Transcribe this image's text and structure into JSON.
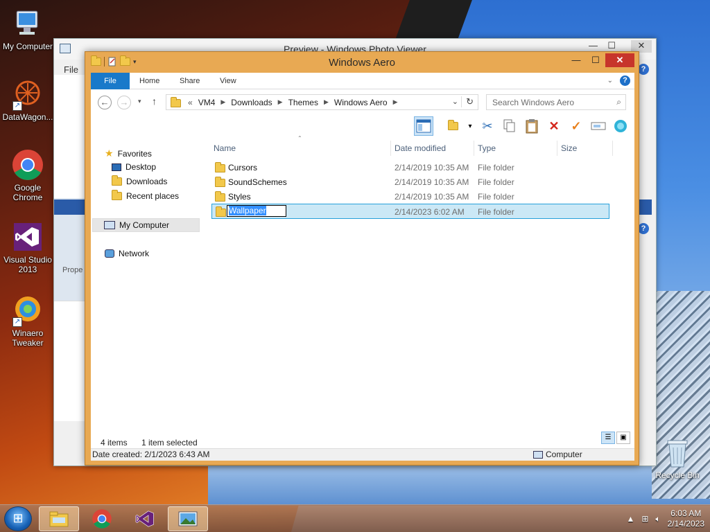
{
  "desktop": {
    "icons": [
      {
        "label": "My Computer",
        "icon": "computer-icon"
      },
      {
        "label": "DataWagon...",
        "icon": "datawagon-icon"
      },
      {
        "label": "Google Chrome",
        "icon": "chrome-icon"
      },
      {
        "label": "Visual Studio 2013",
        "icon": "visual-studio-icon"
      },
      {
        "label": "Winaero Tweaker",
        "icon": "winaero-icon"
      }
    ],
    "recycle_bin": "Recycle Bin"
  },
  "photo_viewer": {
    "title": "Preview - Windows Photo Viewer",
    "menu_file": "File",
    "properties_label": "Prope",
    "help": "?"
  },
  "explorer": {
    "title": "Windows Aero",
    "ribbon_tabs": [
      "File",
      "Home",
      "Share",
      "View"
    ],
    "help": "?",
    "breadcrumb": [
      "VM4",
      "Downloads",
      "Themes",
      "Windows Aero"
    ],
    "breadcrumb_overflow": "«",
    "search_placeholder": "Search Windows Aero",
    "nav": {
      "favorites": "Favorites",
      "desktop": "Desktop",
      "downloads": "Downloads",
      "recent": "Recent places",
      "my_computer": "My Computer",
      "network": "Network"
    },
    "columns": {
      "name": "Name",
      "date": "Date modified",
      "type": "Type",
      "size": "Size"
    },
    "rows": [
      {
        "name": "Cursors",
        "date": "2/14/2019 10:35 AM",
        "type": "File folder"
      },
      {
        "name": "SoundSchemes",
        "date": "2/14/2019 10:35 AM",
        "type": "File folder"
      },
      {
        "name": "Styles",
        "date": "2/14/2019 10:35 AM",
        "type": "File folder"
      },
      {
        "name": "Wallpaper",
        "date": "2/14/2023 6:02 AM",
        "type": "File folder"
      }
    ],
    "status": {
      "items": "4 items",
      "selected": "1 item selected"
    },
    "details": {
      "created": "Date created: 2/1/2023 6:43 AM",
      "location": "Computer"
    }
  },
  "taskbar": {
    "time": "6:03 AM",
    "date": "2/14/2023"
  }
}
